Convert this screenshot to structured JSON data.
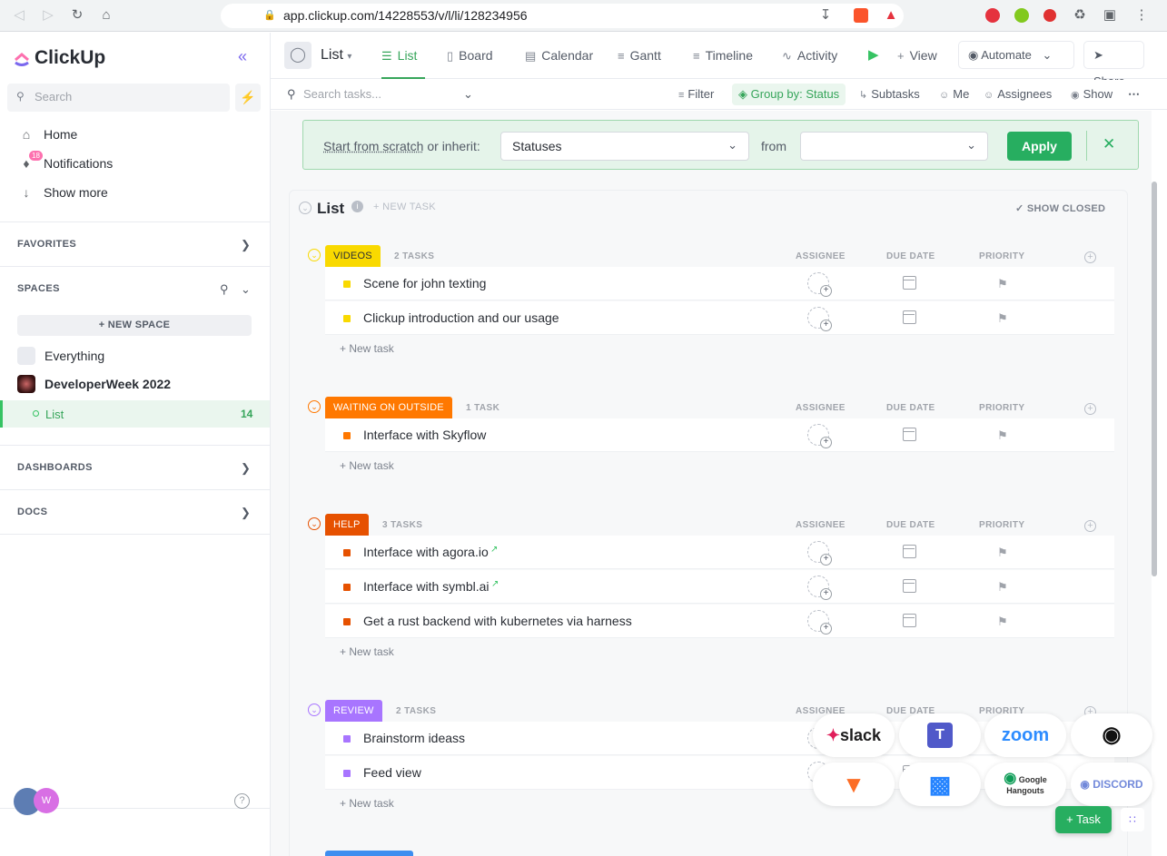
{
  "browser": {
    "url": "app.clickup.com/14228553/v/l/li/128234956",
    "ext_colors": [
      "#e5323e",
      "#82c91e",
      "#e03131"
    ]
  },
  "sidebar": {
    "logo": "ClickUp",
    "search_placeholder": "Search",
    "nav": [
      {
        "label": "Home",
        "icon": "home-icon"
      },
      {
        "label": "Notifications",
        "icon": "bell-icon",
        "badge": "18"
      },
      {
        "label": "Show more",
        "icon": "arrow-down-icon"
      }
    ],
    "favorites": "FAVORITES",
    "spaces": "SPACES",
    "new_space": "+ NEW SPACE",
    "everything": "Everything",
    "space_name": "DeveloperWeek 2022",
    "list_label": "List",
    "list_count": "14",
    "dashboards": "DASHBOARDS",
    "docs": "DOCS",
    "avatar_initials": "W",
    "help": "?"
  },
  "topbar": {
    "title": "List",
    "views": [
      {
        "label": "List",
        "icon": "list-icon",
        "active": true
      },
      {
        "label": "Board",
        "icon": "board-icon"
      },
      {
        "label": "Calendar",
        "icon": "calendar-icon"
      },
      {
        "label": "Gantt",
        "icon": "gantt-icon"
      },
      {
        "label": "Timeline",
        "icon": "timeline-icon"
      },
      {
        "label": "Activity",
        "icon": "activity-icon"
      }
    ],
    "add_view": "View",
    "automate": "Automate",
    "share": "Share"
  },
  "filterbar": {
    "search_placeholder": "Search tasks...",
    "filter": "Filter",
    "group_by": "Group by: Status",
    "subtasks": "Subtasks",
    "me": "Me",
    "assignees": "Assignees",
    "show": "Show"
  },
  "banner": {
    "start_text": "Start from scratch",
    "or_inherit": " or inherit:",
    "statuses": "Statuses",
    "from": "from",
    "from_value": "",
    "apply": "Apply"
  },
  "list": {
    "title": "List",
    "new_task": "+ NEW TASK",
    "show_closed": "✓ SHOW CLOSED",
    "col_assignee": "ASSIGNEE",
    "col_due": "DUE DATE",
    "col_priority": "PRIORITY",
    "new_task_row": "+ New task"
  },
  "groups": [
    {
      "status": "VIDEOS",
      "color": "#f9d900",
      "text_color": "#292d34",
      "count": "2 TASKS",
      "tasks": [
        "Scene for john texting",
        "Clickup introduction and our usage"
      ]
    },
    {
      "status": "WAITING ON OUTSIDE",
      "color": "#ff7800",
      "text_color": "#ffffff",
      "count": "1 TASK",
      "tasks": [
        "Interface with Skyflow"
      ]
    },
    {
      "status": "HELP",
      "color": "#e65100",
      "text_color": "#ffffff",
      "count": "3 TASKS",
      "tasks": [
        "Interface with agora.io",
        "Interface with symbl.ai",
        "Get a rust backend with kubernetes via harness"
      ]
    },
    {
      "status": "REVIEW",
      "color": "#a875ff",
      "text_color": "#ffffff",
      "count": "2 TASKS",
      "tasks": [
        "Brainstorm ideass",
        "Feed view"
      ]
    }
  ],
  "integrations": [
    "slack",
    "teams",
    "zoom",
    "github",
    "gitlab",
    "bitbucket",
    "Google Hangouts",
    "DISCORD"
  ],
  "task_button": "+ Task"
}
